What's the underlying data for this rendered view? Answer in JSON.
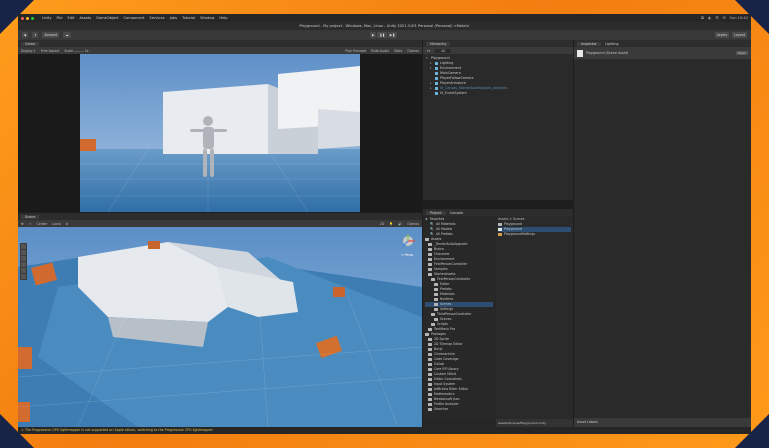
{
  "menubar": {
    "items": [
      "Unity",
      "File",
      "Edit",
      "Assets",
      "GameObject",
      "Component",
      "Services",
      "Jobs",
      "Tutorial",
      "Window",
      "Help"
    ],
    "right": [
      "⌘",
      "◐",
      "☰",
      "✉",
      "Sun 10:42"
    ]
  },
  "titlebar": {
    "title": "Playground - My project - Windows, Mac, Linux - Unity 2021.3.0f1 Personal (Personal) <Metal>"
  },
  "toolbar": {
    "left": [
      "◆",
      "▾",
      "Account",
      "☁"
    ],
    "right": [
      "Layers",
      "Layout"
    ]
  },
  "game": {
    "tabs": [
      "Game"
    ],
    "sub": [
      "Display 1",
      "Free Aspect",
      "Scale ——— 1x",
      "Play Focused",
      "Mute Audio",
      "Stats",
      "Gizmos"
    ]
  },
  "scene": {
    "tabs": [
      "Scene"
    ],
    "sub": [
      "✥",
      "☼",
      "Center",
      "Local",
      "#",
      "2D",
      "💡",
      "🔊",
      "Gizmos"
    ],
    "persp": "< Persp"
  },
  "hierarchy": {
    "tab": "Hierarchy",
    "search": "All",
    "items": [
      {
        "label": "Playground",
        "level": 0,
        "dim": false
      },
      {
        "label": "Lighting",
        "level": 1,
        "dim": false
      },
      {
        "label": "Environment",
        "level": 1,
        "dim": false
      },
      {
        "label": "MainCamera",
        "level": 1,
        "dim": false
      },
      {
        "label": "PlayerFollowCamera",
        "level": 1,
        "dim": false
      },
      {
        "label": "PlayerArmature",
        "level": 1,
        "dim": false
      },
      {
        "label": "UI_Canvas_StarterAssetsInputs_Joysticks",
        "level": 1,
        "dim": true
      },
      {
        "label": "UI_EventSystem",
        "level": 1,
        "dim": false
      }
    ]
  },
  "inspector": {
    "tabs": [
      "Inspector",
      "Lighting"
    ],
    "asset": "Playground (Scene Asset)",
    "open": "Open"
  },
  "project": {
    "tabs": [
      "Project",
      "Console"
    ],
    "breadcrumb": "Assets > Scenes",
    "favorites": [
      "Favorites",
      "All Materials",
      "All Models",
      "All Prefabs"
    ],
    "tree": [
      "Assets",
      "_TerrainAutoUpgrade",
      "Brains",
      "Character",
      "Environment",
      "FirstPersonController",
      "Samples",
      "StarterAssets",
      "FirstPersonController",
      "Editor",
      "Prefabs",
      "Materials",
      "Runtime",
      "Scenes",
      "Settings",
      "ThirdPersonController",
      "Scenes",
      "Scripts",
      "TextMesh Pro",
      "Packages",
      "2D Sprite",
      "2D Tilemap Editor",
      "Burst",
      "Cinemachine",
      "Code Coverage",
      "Collab",
      "Core RP Library",
      "Custom NUnit",
      "Editor Coroutines",
      "Input System",
      "JetBrains Rider Editor",
      "Mathematics",
      "Newtonsoft Json",
      "Profile Analyzer",
      "Searcher"
    ],
    "files": [
      "Playground",
      "Playground",
      "PlaygroundSettings"
    ],
    "footer": "Assets/Scenes/Playground.unity"
  },
  "inspector_footer": "Asset Labels",
  "status": "⚠ The Progressive GPU lightmapper is not supported on Apple silicon, switching to the Progressive CPU lightmapper.",
  "colors": {
    "frame": "#f58a14",
    "corner": "#172447",
    "sky": "#6f9ed1",
    "ground": "#3f7fb4"
  }
}
